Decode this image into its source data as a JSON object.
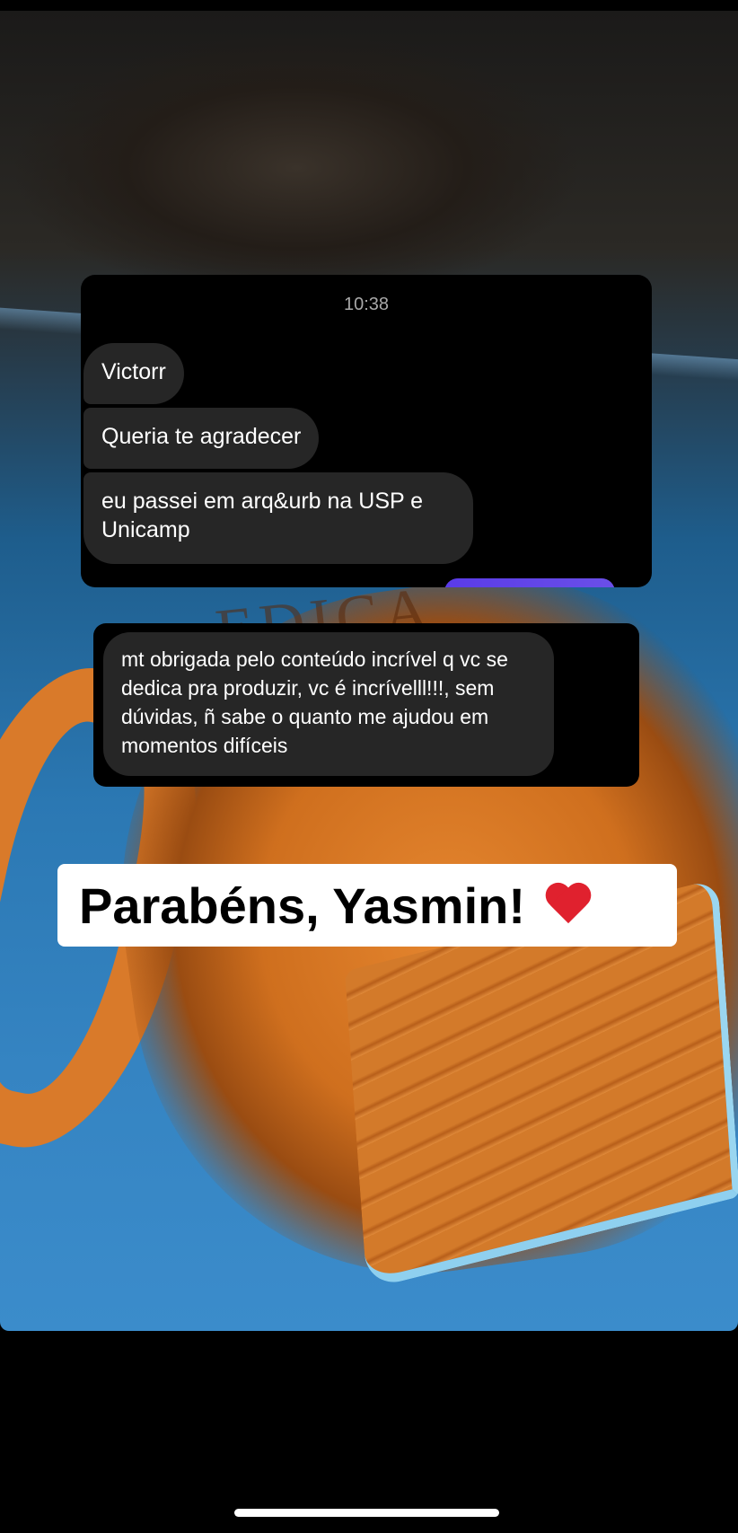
{
  "chat": {
    "timestamp": "10:38",
    "messages": [
      {
        "text": "Victorr"
      },
      {
        "text": "Queria te agradecer"
      },
      {
        "text": "eu passei em arq&urb na USP e Unicamp"
      }
    ]
  },
  "chat_second": {
    "message": "mt obrigada pelo conteúdo incrível q vc se dedica pra produzir, vc é incrívelll!!!, sem dúvidas, ñ sabe o quanto me ajudou em momentos difíceis"
  },
  "caption": {
    "text": "Parabéns, Yasmin!",
    "emoji": "red-heart-icon"
  },
  "colors": {
    "bubble_received": "#262626",
    "bubble_sent_accent": "#5a3be8",
    "heart": "#e0212e",
    "background_photo_blue": "#2b78b3",
    "mug_orange": "#e5862f"
  }
}
